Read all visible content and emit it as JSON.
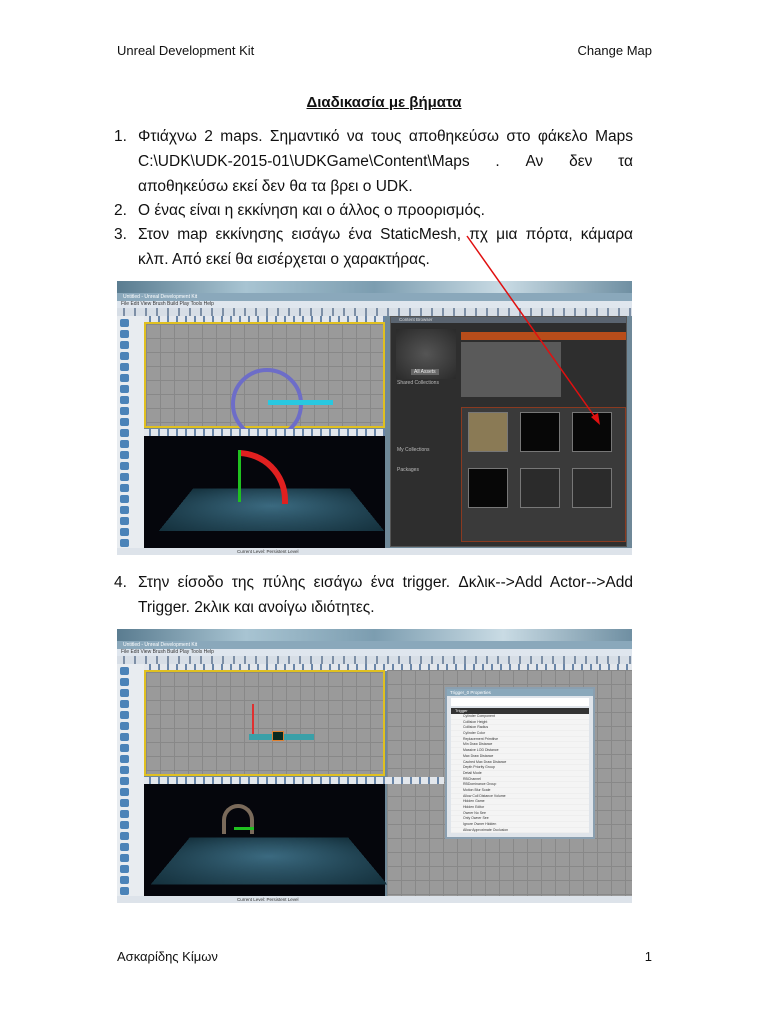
{
  "header": {
    "left": "Unreal Development Kit",
    "right": "Change Map"
  },
  "title": "Διαδικασία με βήματα",
  "steps": [
    {
      "num": "1.",
      "text": "Φτιάχνω 2 maps. Σημαντικό να τους αποθηκεύσω στο φάκελο Maps C:\\UDK\\UDK-2015-01\\UDKGame\\Content\\Maps . Αν δεν τα αποθηκεύσω εκεί δεν θα τα βρει ο UDK."
    },
    {
      "num": "2.",
      "text": "Ο ένας είναι η εκκίνηση και ο άλλος ο προορισμός."
    },
    {
      "num": "3.",
      "text": "Στον map εκκίνησης εισάγω ένα StaticMesh, πχ μια πόρτα, κάμαρα κλπ. Από εκεί θα εισέρχεται ο χαρακτήρας."
    },
    {
      "num": "4.",
      "text": "Στην είσοδο της πύλης εισάγω ένα trigger. Δκλικ-->Add Actor-->Add Trigger. 2κλικ και ανοίγω ιδιότητες."
    }
  ],
  "screenshot1": {
    "window_title": "Untitled - Unreal Development Kit",
    "menu": "File  Edit  View  Brush  Build  Play  Tools  Help",
    "browser_title": "Content Browser",
    "all_assets": "All Assets",
    "shared_collections": "Shared Collections",
    "my_collections": "My Collections",
    "packages": "Packages",
    "status": "Current Level: Persistent Level"
  },
  "screenshot2": {
    "window_title": "Untitled - Unreal Development Kit",
    "menu": "File  Edit  View  Brush  Build  Play  Tools  Help",
    "props_title": "Trigger_0 Properties",
    "props_section": "Trigger",
    "props_rows": [
      "Cylinder Component",
      "Collision Height",
      "Collision Radius",
      "Cylinder Color",
      "Replacement Primitive",
      "Min Draw Distance",
      "Massive LOD Distance",
      "Max Draw Distance",
      "Cached Max Draw Distance",
      "Depth Priority Group",
      "Detail Mode",
      "RBChannel",
      "RBDominance Group",
      "Motion Blur Scale",
      "Allow Cull Distance Volume",
      "Hidden Game",
      "Hidden Editor",
      "Owner No See",
      "Only Owner See",
      "Ignore Owner Hidden",
      "Allow Approximate Occlusion"
    ],
    "status": "Current Level: Persistent Level"
  },
  "footer": {
    "author": "Ασκαρίδης Κίμων",
    "page": "1"
  },
  "colors": {
    "arrow": "#e01010",
    "viewport_border": "#e0c020"
  }
}
